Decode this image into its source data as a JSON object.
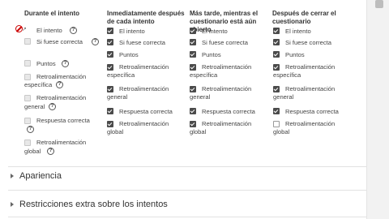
{
  "columns": {
    "during": {
      "header": "Durante el intento",
      "items": [
        {
          "label": "El intento",
          "state": "locked"
        },
        {
          "label": "Si fuese correcta",
          "state": "disabled"
        },
        {
          "label": "Puntos",
          "state": "disabled"
        },
        {
          "label1": "Retroalimentación",
          "label2": "específica",
          "state": "disabled"
        },
        {
          "label1": "Retroalimentación",
          "label2": "general",
          "state": "disabled"
        },
        {
          "label": "Respuesta correcta",
          "state": "disabled"
        },
        {
          "label1": "Retroalimentación",
          "label2": "global",
          "state": "disabled"
        }
      ]
    },
    "immediately": {
      "header1": "Inmediatamente después",
      "header2": "de cada intento",
      "items": [
        {
          "label": "El intento",
          "checked": true
        },
        {
          "label": "Si fuese correcta",
          "checked": true
        },
        {
          "label": "Puntos",
          "checked": true
        },
        {
          "label1": "Retroalimentación",
          "label2": "específica",
          "checked": true
        },
        {
          "label1": "Retroalimentación",
          "label2": "general",
          "checked": true
        },
        {
          "label": "Respuesta correcta",
          "checked": true
        },
        {
          "label1": "Retroalimentación",
          "label2": "global",
          "checked": true
        }
      ]
    },
    "later": {
      "header1": "Más tarde, mientras el",
      "header2": "cuestionario está aún",
      "header3": "abierto",
      "items": [
        {
          "label": "El intento",
          "checked": true
        },
        {
          "label": "Si fuese correcta",
          "checked": true
        },
        {
          "label": "Puntos",
          "checked": true
        },
        {
          "label1": "Retroalimentación",
          "label2": "específica",
          "checked": true
        },
        {
          "label1": "Retroalimentación",
          "label2": "general",
          "checked": true
        },
        {
          "label": "Respuesta correcta",
          "checked": true
        },
        {
          "label1": "Retroalimentación",
          "label2": "global",
          "checked": true
        }
      ]
    },
    "after": {
      "header1": "Después de cerrar el",
      "header2": "cuestionario",
      "items": [
        {
          "label": "El intento",
          "checked": true
        },
        {
          "label": "Si fuese correcta",
          "checked": true
        },
        {
          "label": "Puntos",
          "checked": true
        },
        {
          "label1": "Retroalimentación",
          "label2": "específica",
          "checked": true
        },
        {
          "label1": "Retroalimentación",
          "label2": "general",
          "checked": true
        },
        {
          "label": "Respuesta correcta",
          "checked": true
        },
        {
          "label1": "Retroalimentación",
          "label2": "global",
          "checked": false
        }
      ]
    }
  },
  "sections": {
    "appearance": "Apariencia",
    "restrictions": "Restricciones extra sobre los intentos"
  }
}
